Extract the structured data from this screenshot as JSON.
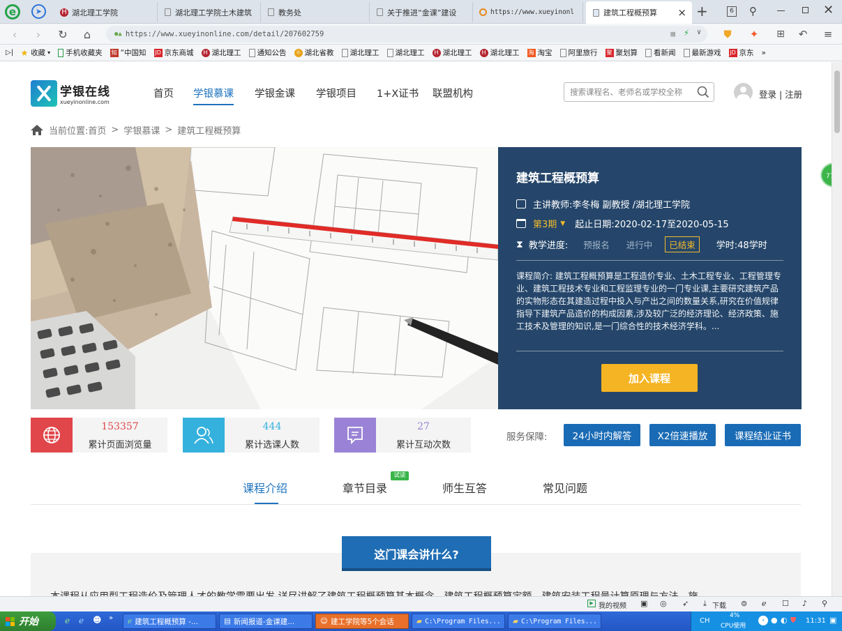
{
  "browser": {
    "tabs": [
      {
        "label": "湖北理工学院",
        "icon": "university-icon"
      },
      {
        "label": "湖北理工学院土木建筑",
        "icon": "page-icon"
      },
      {
        "label": "教务处",
        "icon": "page-icon"
      },
      {
        "label": "关于推进“金课”建设",
        "icon": "page-icon"
      },
      {
        "label": "https://www.xueyinonl",
        "icon": "search-icon"
      },
      {
        "label": "建筑工程概预算",
        "icon": "page-icon"
      }
    ],
    "close_glyph": "×",
    "newtab_glyph": "+",
    "tab_count": "6",
    "url": "https://www.xueyinonline.com/detail/207602759",
    "bookmarks": [
      "收藏",
      "手机收藏夹",
      "“中国知",
      "京东商城",
      "湖北理工",
      "通知公告",
      "湖北省教",
      "湖北理工",
      "湖北理工",
      "湖北理工",
      "湖北理工",
      "淘宝",
      "阿里旅行",
      "聚划算",
      "看新闻",
      "最新游戏",
      "京东",
      "»"
    ]
  },
  "site": {
    "logo_cn": "学银在线",
    "logo_en": "xueyinonline.com",
    "nav": [
      "首页",
      "学银慕课",
      "学银金课",
      "学银项目",
      "1+X证书",
      "联盟机构"
    ],
    "nav_active": 1,
    "search_placeholder": "搜索课程名、老师名或学校全称",
    "login": "登录 | 注册"
  },
  "breadcrumb": {
    "prefix": "当前位置:",
    "items": [
      "首页",
      "学银慕课",
      "建筑工程概预算"
    ],
    "sep": ">"
  },
  "course": {
    "title": "建筑工程概预算",
    "teacher": "主讲教师:李冬梅 副教授 /湖北理工学院",
    "term": "第3期",
    "dates": "起止日期:2020-02-17至2020-05-15",
    "progress_label": "教学进度:",
    "progress_states": [
      "预报名",
      "进行中",
      "已结束"
    ],
    "hours": "学时:48学时",
    "intro": "课程简介: 建筑工程概预算是工程造价专业、土木工程专业、工程管理专业、建筑工程技术专业和工程监理专业的一门专业课,主要研究建筑产品的实物形态在其建造过程中投入与产出之间的数量关系,研究在价值规律指导下建筑产品造价的构成因素,涉及较广泛的经济理论、经济政策、施工技术及管理的知识,是一门综合性的技术经济学科。...",
    "join_button": "加入课程"
  },
  "stats": [
    {
      "value": "153357",
      "label": "累计页面浏览量",
      "color": "#e0464a"
    },
    {
      "value": "444",
      "label": "累计选课人数",
      "color": "#35b1dd"
    },
    {
      "value": "27",
      "label": "累计互动次数",
      "color": "#9a83d6"
    }
  ],
  "service": {
    "label": "服务保障:",
    "buttons": [
      "24小时内解答",
      "X2倍速播放",
      "课程结业证书"
    ]
  },
  "content_tabs": [
    "课程介绍",
    "章节目录",
    "师生互答",
    "常见问题"
  ],
  "trial_badge": "试读",
  "section_title": "这门课会讲什么?",
  "section_text": "本课程从应用型工程造价及管理人才的教学需要出发,详尽讲解了建筑工程概预算基本概念、建筑工程概预算定额、建筑安装工程量计算原理与方法、施",
  "statusbar": {
    "items": [
      "我的视频",
      "下载"
    ],
    "float_badge": "77"
  },
  "taskbar": {
    "start": "开始",
    "windows": [
      "建筑工程概预算 -...",
      "新闻报道-金课建...",
      "建工学院等5个会话",
      "C:\\Program Files...",
      "C:\\Program Files..."
    ],
    "ime": "CH",
    "cpu": "4%",
    "cpu_label": "CPU使用",
    "time": "11:31"
  },
  "colors": {
    "accent": "#1e73be",
    "panel": "#25466a",
    "join": "#f5b423",
    "finished": "#f2bb2c"
  }
}
